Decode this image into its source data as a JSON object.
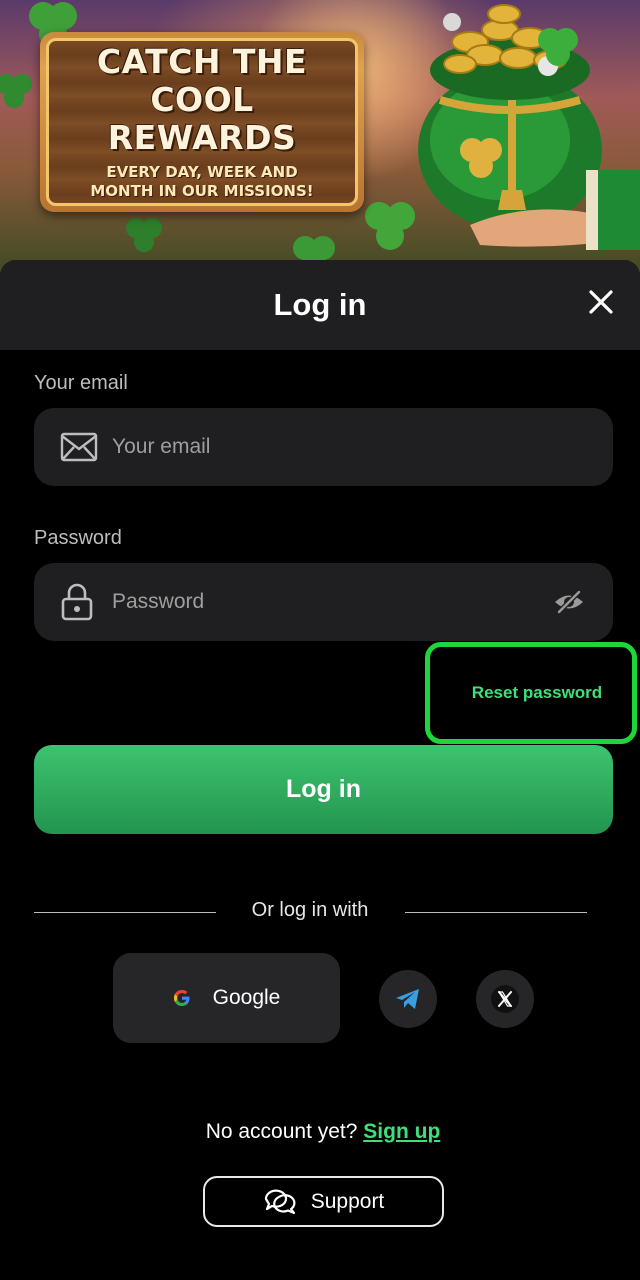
{
  "banner": {
    "title": "CATCH THE COOL\nREWARDS",
    "subtitle": "EVERY DAY, WEEK AND MONTH IN OUR MISSIONS!"
  },
  "modal": {
    "title": "Log in",
    "close_icon": "close-icon"
  },
  "email": {
    "label": "Your email",
    "placeholder": "Your email",
    "value": "",
    "icon": "envelope-icon"
  },
  "password": {
    "label": "Password",
    "placeholder": "Password",
    "value": "",
    "icon": "lock-icon",
    "toggle_icon": "eye-slash-icon"
  },
  "reset_password": "Reset password",
  "login_button": "Log in",
  "social": {
    "divider_text": "Or log in with",
    "google_label": "Google",
    "icons": [
      "google-icon",
      "telegram-icon",
      "x-icon"
    ]
  },
  "signup": {
    "prompt": "No account yet?",
    "link": "Sign up"
  },
  "support": {
    "label": "Support",
    "icon": "chat-icon"
  },
  "colors": {
    "accent_green": "#3ee07a",
    "button_green": "#2faa5e",
    "highlight_border": "#1fd63a",
    "field_bg": "#1f1f21"
  }
}
